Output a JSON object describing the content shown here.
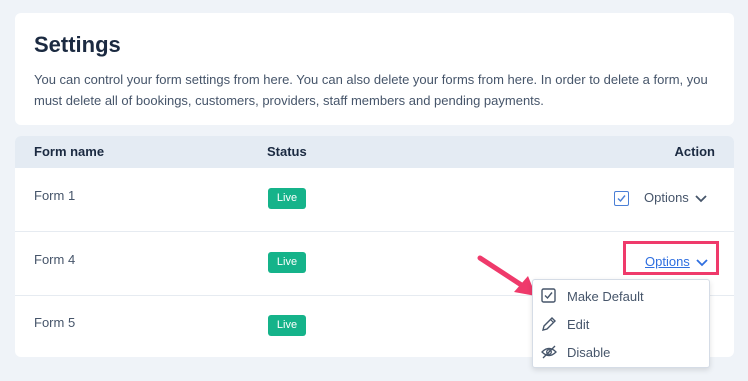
{
  "settings": {
    "title": "Settings",
    "description": "You can control your form settings from here. You can also delete your forms from here. In order to delete a form, you must delete all of bookings, customers, providers, staff members and pending payments."
  },
  "table": {
    "columns": {
      "name": "Form name",
      "status": "Status",
      "action": "Action"
    },
    "rows": [
      {
        "name": "Form 1",
        "status": "Live",
        "action": "Options"
      },
      {
        "name": "Form 4",
        "status": "Live",
        "action": "Options"
      },
      {
        "name": "Form 5",
        "status": "Live",
        "action": ""
      }
    ]
  },
  "dropdown": {
    "items": [
      {
        "label": "Make Default",
        "icon": "checkbox-check-icon"
      },
      {
        "label": "Edit",
        "icon": "pencil-icon"
      },
      {
        "label": "Disable",
        "icon": "eye-slash-icon"
      }
    ]
  },
  "colors": {
    "badge": "#15b38a",
    "link": "#2f6fe0",
    "highlight": "#ef3a6b"
  }
}
